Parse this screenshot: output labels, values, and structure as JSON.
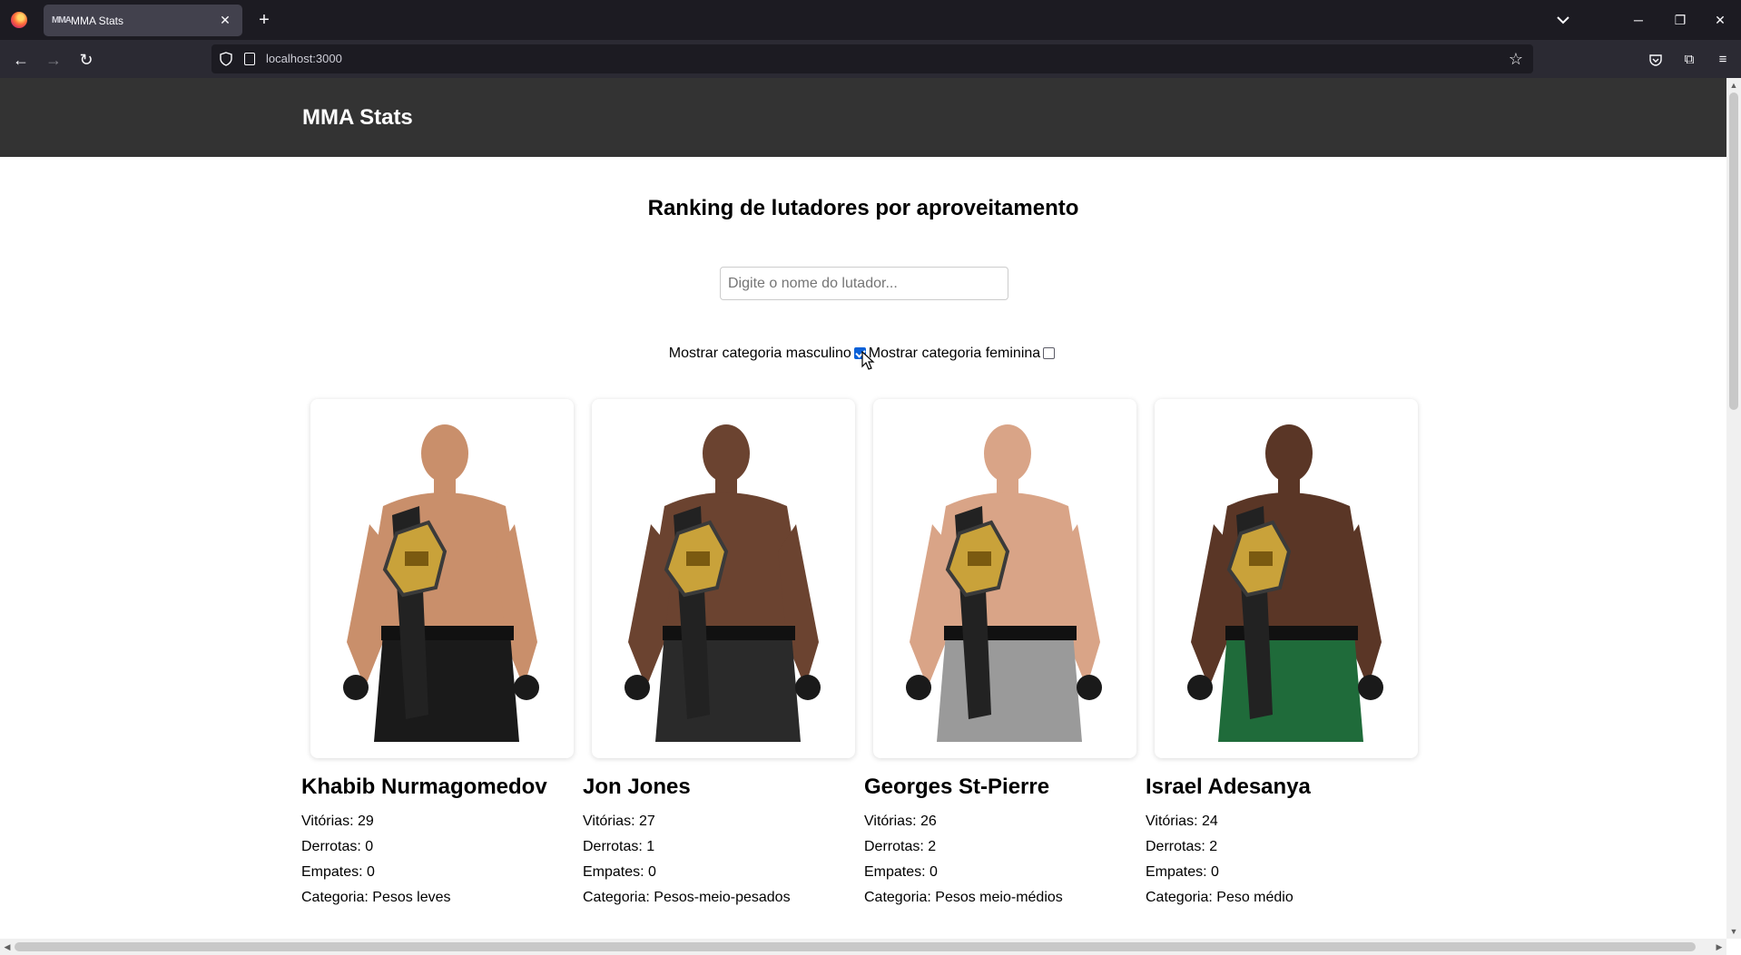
{
  "browser": {
    "tab_title": "MMA Stats",
    "tab_favicon_text": "MMA",
    "url": "localhost:3000",
    "icons": [
      "firefox-logo",
      "close-icon",
      "plus-icon",
      "chevron-down-icon",
      "minimize-icon",
      "restore-icon",
      "close-window-icon",
      "back-arrow-icon",
      "forward-arrow-icon",
      "reload-icon",
      "shield-icon",
      "page-icon",
      "star-icon",
      "pocket-icon",
      "extensions-icon",
      "menu-icon"
    ]
  },
  "site": {
    "title": "MMA Stats",
    "header_bg": "#333333"
  },
  "main": {
    "heading": "Ranking de lutadores por aproveitamento",
    "search_placeholder": "Digite o nome do lutador...",
    "search_value": "",
    "filter_male_label": "Mostrar categoria masculino",
    "filter_male_checked": true,
    "filter_female_label": "Mostrar categoria feminina",
    "filter_female_checked": false
  },
  "fighters": [
    {
      "name": "Khabib Nurmagomedov",
      "wins": "Vitórias: 29",
      "losses": "Derrotas: 0",
      "draws": "Empates: 0",
      "category": "Categoria: Pesos leves",
      "shorts_color": "#1a1a1a",
      "skin_color": "#c98f6b"
    },
    {
      "name": "Jon Jones",
      "wins": "Vitórias: 27",
      "losses": "Derrotas: 1",
      "draws": "Empates: 0",
      "category": "Categoria: Pesos-meio-pesados",
      "shorts_color": "#2a2a2a",
      "skin_color": "#6b4330"
    },
    {
      "name": "Georges St-Pierre",
      "wins": "Vitórias: 26",
      "losses": "Derrotas: 2",
      "draws": "Empates: 0",
      "category": "Categoria: Pesos meio-médios",
      "shorts_color": "#9a9a9a",
      "skin_color": "#d9a487"
    },
    {
      "name": "Israel Adesanya",
      "wins": "Vitórias: 24",
      "losses": "Derrotas: 2",
      "draws": "Empates: 0",
      "category": "Categoria: Peso médio",
      "shorts_color": "#1f6b3a",
      "skin_color": "#5a3626"
    }
  ]
}
